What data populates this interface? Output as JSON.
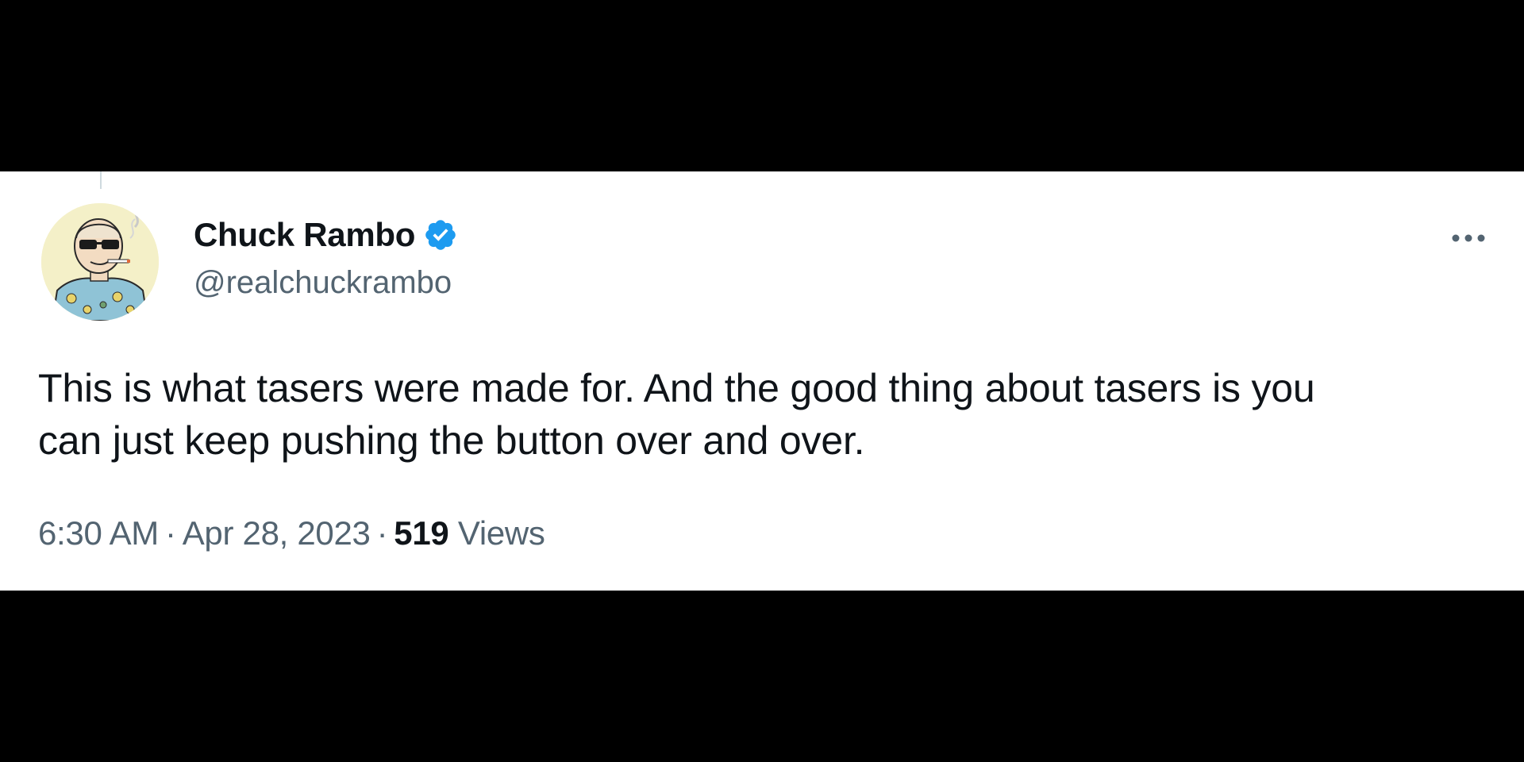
{
  "tweet": {
    "author": {
      "display_name": "Chuck Rambo",
      "handle": "@realchuckrambo",
      "verified": true,
      "avatar_icon": "cartoon-avatar-sunglasses-hawaiian-shirt"
    },
    "text_lines": [
      "This is what tasers were made for. And the good thing about tasers is you",
      "can just keep pushing the button over and over."
    ],
    "time": "6:30 AM",
    "date": "Apr 28, 2023",
    "separator": "·",
    "views_count": "519",
    "views_label": "Views",
    "more_icon": "more-horizontal-icon"
  },
  "colors": {
    "background_bars": "#000000",
    "card_background": "#ffffff",
    "primary_text": "#0f1419",
    "secondary_text": "#536471",
    "verified_blue": "#1d9bf0"
  }
}
